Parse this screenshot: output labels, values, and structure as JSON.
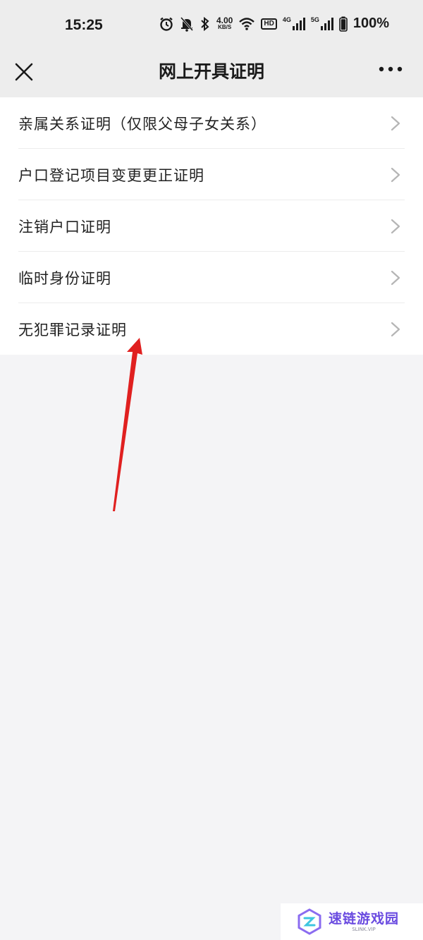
{
  "status_bar": {
    "time": "15:25",
    "speed_value": "4.00",
    "speed_unit": "KB/S",
    "hd_label": "HD",
    "net1_label": "4G",
    "net2_label": "5G",
    "battery": "100%"
  },
  "nav": {
    "title": "网上开具证明"
  },
  "list": {
    "items": [
      {
        "label": "亲属关系证明（仅限父母子女关系）"
      },
      {
        "label": "户口登记项目变更更正证明"
      },
      {
        "label": "注销户口证明"
      },
      {
        "label": "临时身份证明"
      },
      {
        "label": "无犯罪记录证明"
      }
    ]
  },
  "watermark": {
    "title": "速链游戏园",
    "subtitle": "SLINK.VIP"
  },
  "colors": {
    "background": "#f4f4f6",
    "header": "#ededed",
    "list_bg": "#ffffff",
    "chevron": "#b5b5b5",
    "annotation_arrow": "#e02020",
    "watermark_accent": "#6a4be0"
  }
}
